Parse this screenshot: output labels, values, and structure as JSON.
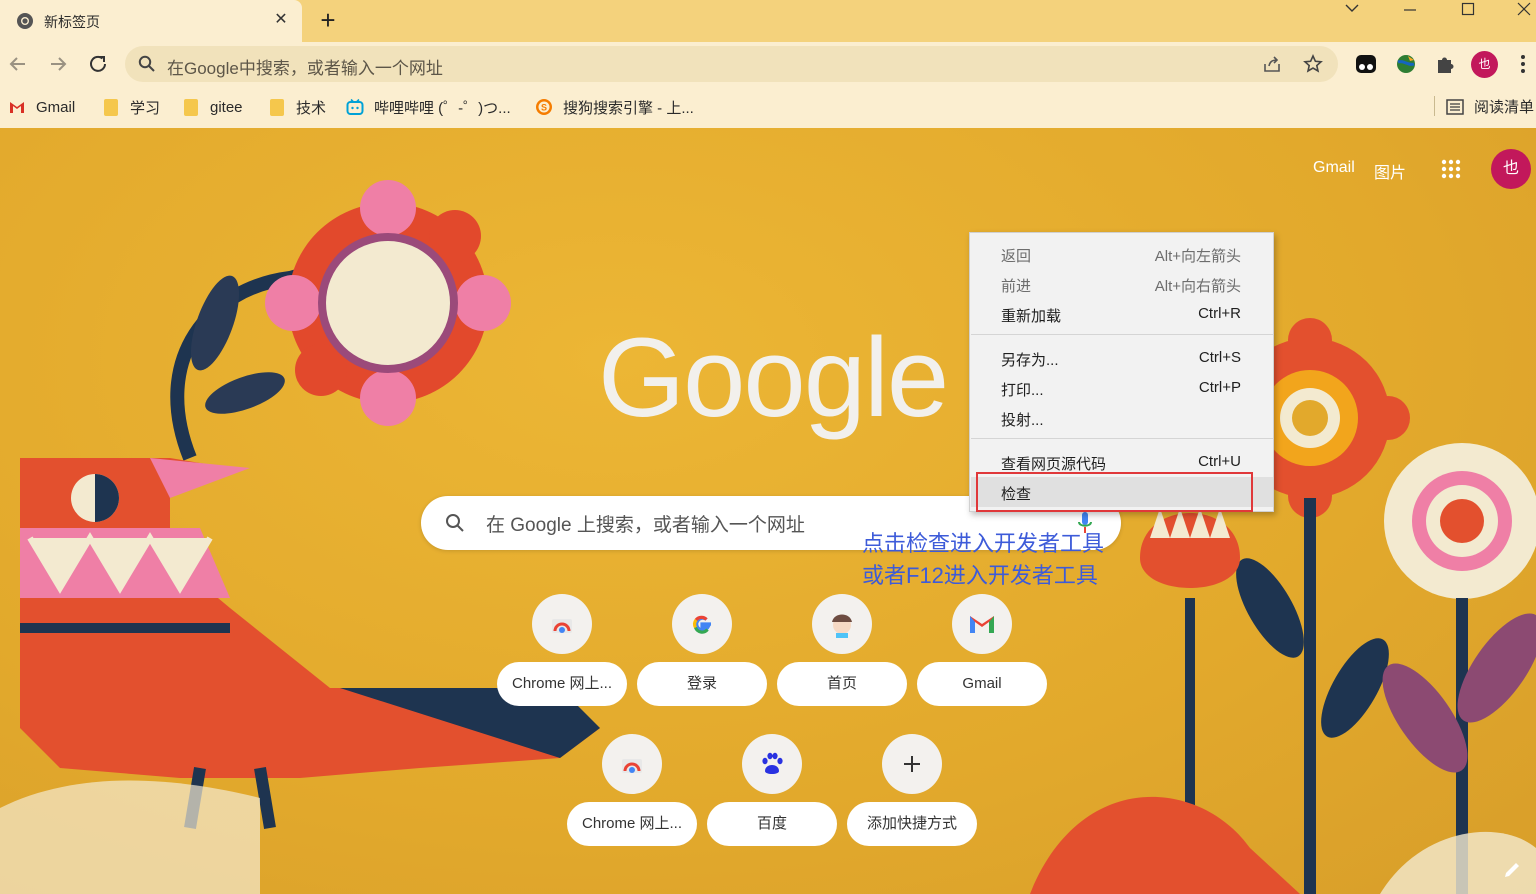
{
  "tab": {
    "title": "新标签页",
    "close": "✕"
  },
  "toolbar": {
    "omnibox_text": "在Google中搜索，或者输入一个网址",
    "profile_initial": "也"
  },
  "bookmarks": [
    {
      "label": "Gmail"
    },
    {
      "label": "学习"
    },
    {
      "label": "gitee"
    },
    {
      "label": "技术"
    },
    {
      "label": "哔哩哔哩 (゜-゜)つ..."
    },
    {
      "label": "搜狗搜索引擎 - 上..."
    }
  ],
  "reading_list": "阅读清单",
  "page": {
    "gmail_link": "Gmail",
    "images_link": "图片",
    "avatar_initial": "也",
    "logo": "Google",
    "search_placeholder": "在 Google 上搜索，或者输入一个网址",
    "annotation_line1": "点击检查进入开发者工具",
    "annotation_line2": "或者F12进入开发者工具"
  },
  "shortcuts": [
    {
      "label": "Chrome 网上..."
    },
    {
      "label": "登录"
    },
    {
      "label": "首页"
    },
    {
      "label": "Gmail"
    },
    {
      "label": "Chrome 网上..."
    },
    {
      "label": "百度"
    },
    {
      "label": "添加快捷方式"
    }
  ],
  "context_menu": {
    "items": [
      {
        "label": "返回",
        "shortcut": "Alt+向左箭头"
      },
      {
        "label": "前进",
        "shortcut": "Alt+向右箭头"
      },
      {
        "label": "重新加载",
        "shortcut": "Ctrl+R"
      },
      {
        "label": "另存为...",
        "shortcut": "Ctrl+S"
      },
      {
        "label": "打印...",
        "shortcut": "Ctrl+P"
      },
      {
        "label": "投射...",
        "shortcut": ""
      },
      {
        "label": "查看网页源代码",
        "shortcut": "Ctrl+U"
      },
      {
        "label": "检查",
        "shortcut": ""
      }
    ]
  },
  "colors": {
    "accent_red": "#e0383a",
    "annotation_blue": "#3d5bd9",
    "avatar": "#c2185b"
  }
}
